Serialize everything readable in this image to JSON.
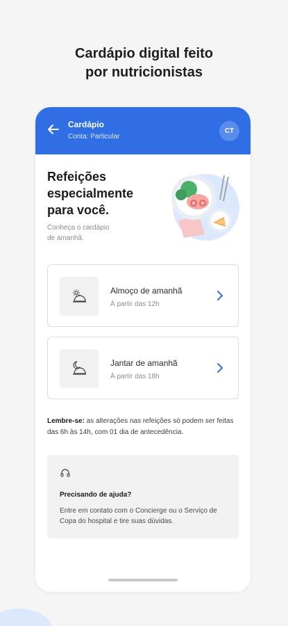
{
  "promo": {
    "headline_line1": "Cardápio digital feito",
    "headline_line2": "por nutricionistas"
  },
  "appbar": {
    "title": "Cardápio",
    "subtitle": "Conta: Particular",
    "avatar_initials": "CT",
    "back_icon": "arrow-left-icon",
    "color": "#2f6ee4"
  },
  "hero": {
    "title_line1": "Refeições",
    "title_line2": "especialmente",
    "title_line3": "para você.",
    "sub_line1": "Conheça o cardápio",
    "sub_line2": "de amanhã."
  },
  "meals": [
    {
      "title": "Almoço de amanhã",
      "subtitle": "À partir das 12h",
      "icon": "sun-cloche-icon"
    },
    {
      "title": "Jantar de amanhã",
      "subtitle": "À partir das 18h",
      "icon": "moon-cloche-icon"
    }
  ],
  "reminder": {
    "label": "Lembre-se:",
    "text": " as alterações nas refeições só podem ser feitas das 6h às 14h, com 01 dia de antecedência."
  },
  "help": {
    "icon": "headset-icon",
    "title": "Precisando de ajuda?",
    "text": "Entre em contato com o Concierge ou o Serviço de Copa do hospital e tire suas dúvidas."
  }
}
